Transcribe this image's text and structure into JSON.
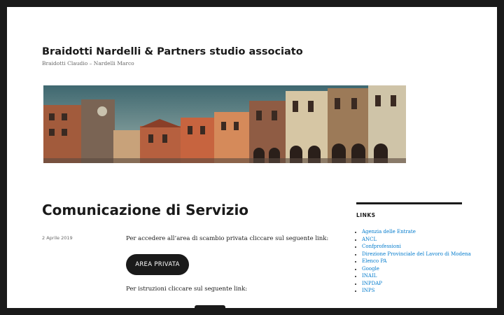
{
  "site": {
    "title": "Braidotti Nardelli & Partners studio associato",
    "description": "Braidotti Claudio – Nardelli Marco"
  },
  "post": {
    "title": "Comunicazione di Servizio",
    "date": "2 Aprile 2019",
    "text_1": "Per accedere all’area di scambio privata cliccare sul seguente link:",
    "button_label": "AREA PRIVATA",
    "text_2": "Per istruzioni cliccare sul seguente link:"
  },
  "sidebar": {
    "widget_title": "LINKS",
    "links": [
      "Agenzia delle Entrate",
      "ANCL",
      "Confprofessioni",
      "Direzione Provinciale del Lavoro di Modena",
      "Elenco PA",
      "Google",
      "INAIL",
      "INPDAP",
      "INPS"
    ]
  },
  "colors": {
    "page_background": "#ffffff",
    "frame": "#1a1a1a",
    "text": "#1a1a1a",
    "muted": "#686868",
    "link": "#007acc"
  }
}
